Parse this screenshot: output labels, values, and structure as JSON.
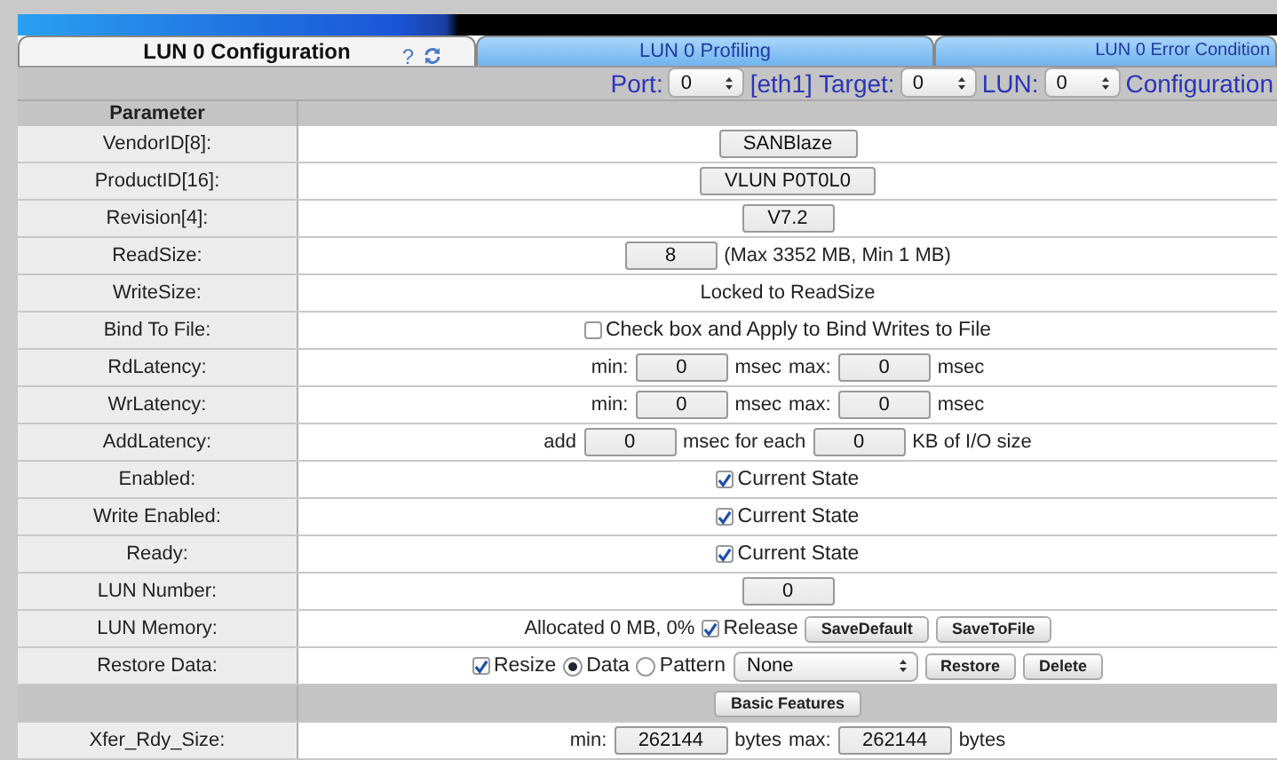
{
  "tabs": [
    {
      "label": "LUN 0 Configuration",
      "selected": true
    },
    {
      "label": "LUN 0 Profiling",
      "selected": false
    },
    {
      "label": "LUN 0 Error Condition",
      "selected": false
    }
  ],
  "help": "?",
  "selector_bar": [
    {
      "kind": "text",
      "text": "Port:"
    },
    {
      "kind": "select",
      "value": "0"
    },
    {
      "kind": "text",
      "text": "[eth1] Target:"
    },
    {
      "kind": "select",
      "value": "0"
    },
    {
      "kind": "text",
      "text": "LUN:"
    },
    {
      "kind": "select",
      "value": "0"
    },
    {
      "kind": "text",
      "text": "Configuration"
    }
  ],
  "table": {
    "header": "Parameter",
    "rows": [
      {
        "kind": "param",
        "label": "VendorID[8]:",
        "parts": [
          {
            "kind": "field",
            "value": "SANBlaze"
          }
        ]
      },
      {
        "kind": "param",
        "label": "ProductID[16]:",
        "parts": [
          {
            "kind": "field",
            "value": "VLUN P0T0L0"
          }
        ]
      },
      {
        "kind": "param",
        "label": "Revision[4]:",
        "parts": [
          {
            "kind": "field",
            "value": "V7.2"
          }
        ]
      },
      {
        "kind": "param",
        "label": "ReadSize:",
        "parts": [
          {
            "kind": "field",
            "value": "8"
          },
          {
            "kind": "text",
            "text": "(Max 3352 MB, Min 1 MB)"
          }
        ]
      },
      {
        "kind": "param",
        "label": "WriteSize:",
        "parts": [
          {
            "kind": "text",
            "text": "Locked to ReadSize"
          }
        ]
      },
      {
        "kind": "param",
        "label": "Bind To File:",
        "parts": [
          {
            "kind": "checkbox",
            "label": "Check box and Apply to Bind Writes to File",
            "checked": false
          }
        ]
      },
      {
        "kind": "param",
        "label": "RdLatency:",
        "parts": [
          {
            "kind": "text",
            "text": "min:"
          },
          {
            "kind": "field",
            "value": "0"
          },
          {
            "kind": "text",
            "text": "msec"
          },
          {
            "kind": "text",
            "text": "max:"
          },
          {
            "kind": "field",
            "value": "0"
          },
          {
            "kind": "text",
            "text": "msec"
          }
        ]
      },
      {
        "kind": "param",
        "label": "WrLatency:",
        "parts": [
          {
            "kind": "text",
            "text": "min:"
          },
          {
            "kind": "field",
            "value": "0"
          },
          {
            "kind": "text",
            "text": "msec"
          },
          {
            "kind": "text",
            "text": "max:"
          },
          {
            "kind": "field",
            "value": "0"
          },
          {
            "kind": "text",
            "text": "msec"
          }
        ]
      },
      {
        "kind": "param",
        "label": "AddLatency:",
        "parts": [
          {
            "kind": "text",
            "text": "add"
          },
          {
            "kind": "field",
            "value": "0"
          },
          {
            "kind": "text",
            "text": "msec for each"
          },
          {
            "kind": "field",
            "value": "0"
          },
          {
            "kind": "text",
            "text": "KB of I/O size"
          }
        ]
      },
      {
        "kind": "param",
        "label": "Enabled:",
        "parts": [
          {
            "kind": "checkbox",
            "label": "Current State",
            "checked": true
          }
        ]
      },
      {
        "kind": "param",
        "label": "Write Enabled:",
        "parts": [
          {
            "kind": "checkbox",
            "label": "Current State",
            "checked": true
          }
        ]
      },
      {
        "kind": "param",
        "label": "Ready:",
        "parts": [
          {
            "kind": "checkbox",
            "label": "Current State",
            "checked": true
          }
        ]
      },
      {
        "kind": "param",
        "label": "LUN Number:",
        "parts": [
          {
            "kind": "field",
            "value": "0"
          }
        ]
      },
      {
        "kind": "param",
        "label": "LUN Memory:",
        "parts": [
          {
            "kind": "text",
            "text": "Allocated 0 MB, 0%"
          },
          {
            "kind": "checkbox",
            "label": "Release",
            "checked": true
          },
          {
            "kind": "button",
            "label": "SaveDefault"
          },
          {
            "kind": "button",
            "label": "SaveToFile"
          }
        ]
      },
      {
        "kind": "param",
        "label": "Restore Data:",
        "parts": [
          {
            "kind": "checkbox",
            "label": "Resize",
            "checked": true
          },
          {
            "kind": "radio",
            "label": "Data",
            "selected": true
          },
          {
            "kind": "radio",
            "label": "Pattern",
            "selected": false
          },
          {
            "kind": "select",
            "value": "None"
          },
          {
            "kind": "button",
            "label": "Restore"
          },
          {
            "kind": "button",
            "label": "Delete"
          }
        ]
      },
      {
        "kind": "section",
        "parts": [
          {
            "kind": "button",
            "label": "Basic Features"
          }
        ]
      },
      {
        "kind": "param",
        "label": "Xfer_Rdy_Size:",
        "parts": [
          {
            "kind": "text",
            "text": "min:"
          },
          {
            "kind": "field",
            "value": "262144"
          },
          {
            "kind": "text",
            "text": "bytes"
          },
          {
            "kind": "text",
            "text": "max:"
          },
          {
            "kind": "field",
            "value": "262144"
          },
          {
            "kind": "text",
            "text": "bytes"
          }
        ]
      }
    ]
  }
}
